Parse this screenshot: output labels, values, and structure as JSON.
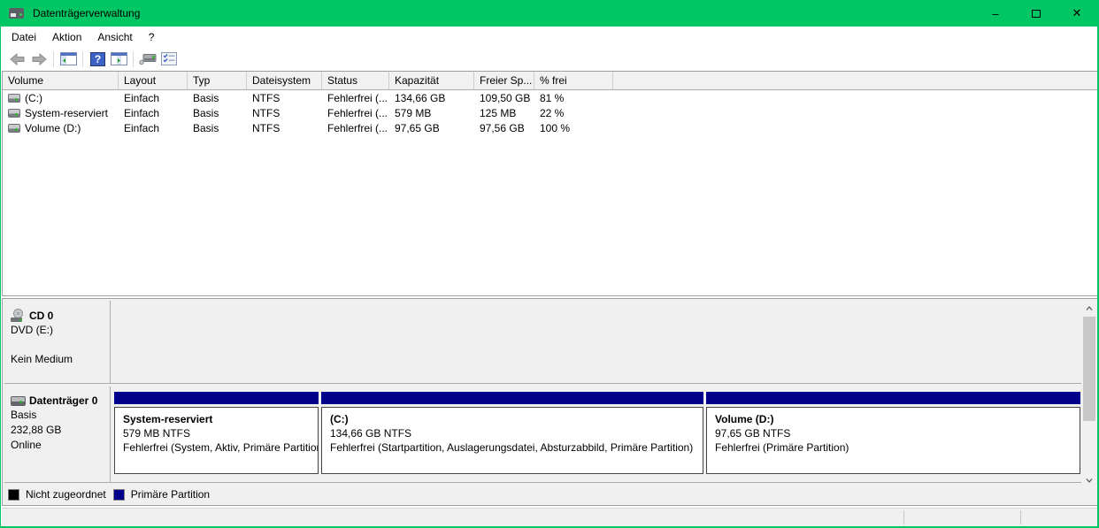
{
  "window": {
    "title": "Datenträgerverwaltung",
    "controls": {
      "minimize": "–",
      "maximize": "maximize",
      "close": "✕"
    }
  },
  "menu": {
    "items": [
      "Datei",
      "Aktion",
      "Ansicht",
      "?"
    ]
  },
  "toolbar": {
    "icons": [
      "back",
      "forward",
      "show-console-tree",
      "help",
      "show-action-pane",
      "device-properties",
      "action-checklist"
    ]
  },
  "volume_list": {
    "columns": [
      "Volume",
      "Layout",
      "Typ",
      "Dateisystem",
      "Status",
      "Kapazität",
      "Freier Sp...",
      "% frei"
    ],
    "rows": [
      {
        "volume": "(C:)",
        "layout": "Einfach",
        "typ": "Basis",
        "dateisystem": "NTFS",
        "status": "Fehlerfrei (...",
        "kapazitaet": "134,66 GB",
        "freier": "109,50 GB",
        "frei_pct": "81 %"
      },
      {
        "volume": "System-reserviert",
        "layout": "Einfach",
        "typ": "Basis",
        "dateisystem": "NTFS",
        "status": "Fehlerfrei (...",
        "kapazitaet": "579 MB",
        "freier": "125 MB",
        "frei_pct": "22 %"
      },
      {
        "volume": "Volume (D:)",
        "layout": "Einfach",
        "typ": "Basis",
        "dateisystem": "NTFS",
        "status": "Fehlerfrei (...",
        "kapazitaet": "97,65 GB",
        "freier": "97,56 GB",
        "frei_pct": "100 %"
      }
    ]
  },
  "graphical_view": {
    "cd_drive": {
      "name": "CD 0",
      "drive": "DVD (E:)",
      "status": "Kein Medium"
    },
    "disk0": {
      "name": "Datenträger 0",
      "type": "Basis",
      "size": "232,88 GB",
      "status": "Online",
      "partitions": [
        {
          "name": "System-reserviert",
          "size": "579 MB NTFS",
          "status": "Fehlerfrei (System, Aktiv, Primäre Partition)"
        },
        {
          "name": "(C:)",
          "size": "134,66 GB NTFS",
          "status": "Fehlerfrei (Startpartition, Auslagerungsdatei, Absturzabbild, Primäre Partition)"
        },
        {
          "name": "Volume  (D:)",
          "size": "97,65 GB NTFS",
          "status": "Fehlerfrei (Primäre Partition)"
        }
      ]
    }
  },
  "legend": {
    "items": [
      {
        "label": "Nicht zugeordnet",
        "color": "#000000"
      },
      {
        "label": "Primäre Partition",
        "color": "#00008B"
      }
    ]
  },
  "colors": {
    "titlebar_green": "#00C763",
    "partition_primary": "#00008B",
    "unallocated": "#000000"
  }
}
